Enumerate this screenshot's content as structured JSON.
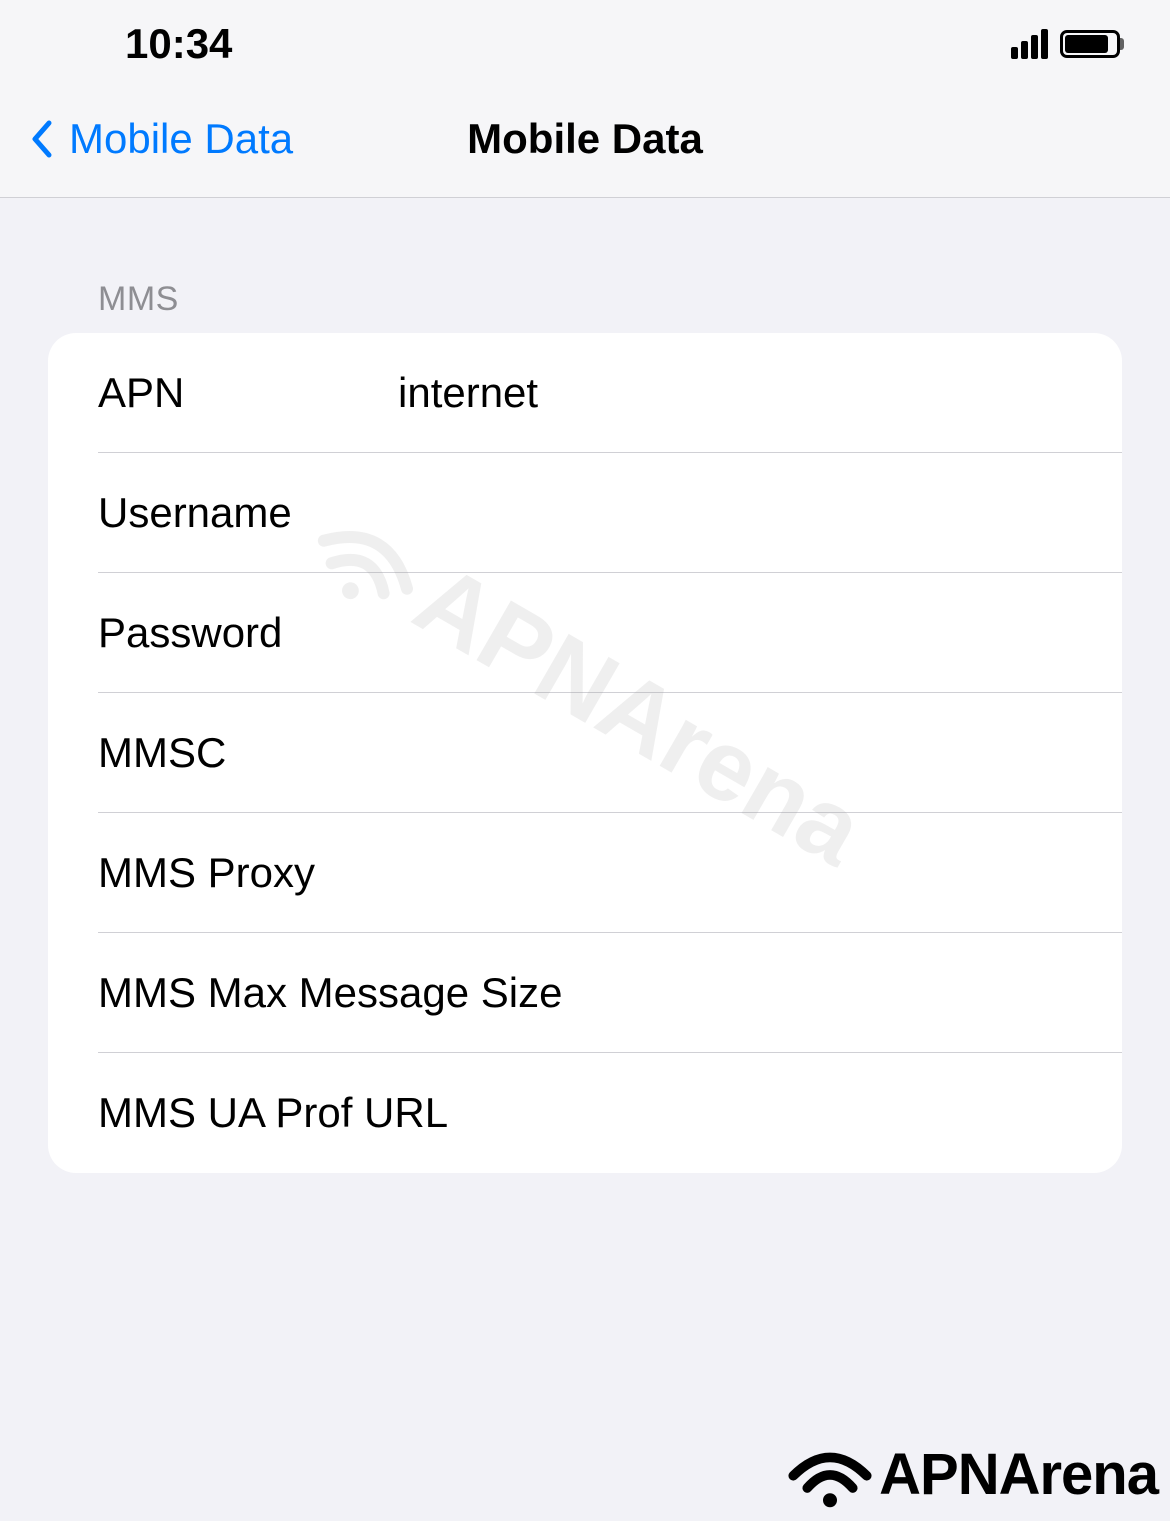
{
  "statusBar": {
    "time": "10:34"
  },
  "nav": {
    "backLabel": "Mobile Data",
    "title": "Mobile Data"
  },
  "section": {
    "header": "MMS",
    "rows": {
      "apn": {
        "label": "APN",
        "value": "internet"
      },
      "username": {
        "label": "Username",
        "value": ""
      },
      "password": {
        "label": "Password",
        "value": ""
      },
      "mmsc": {
        "label": "MMSC",
        "value": ""
      },
      "mmsProxy": {
        "label": "MMS Proxy",
        "value": ""
      },
      "mmsMaxSize": {
        "label": "MMS Max Message Size",
        "value": ""
      },
      "mmsUaProf": {
        "label": "MMS UA Prof URL",
        "value": ""
      }
    }
  },
  "watermark": {
    "text": "APNArena"
  },
  "footer": {
    "logoText": "APNArena"
  }
}
